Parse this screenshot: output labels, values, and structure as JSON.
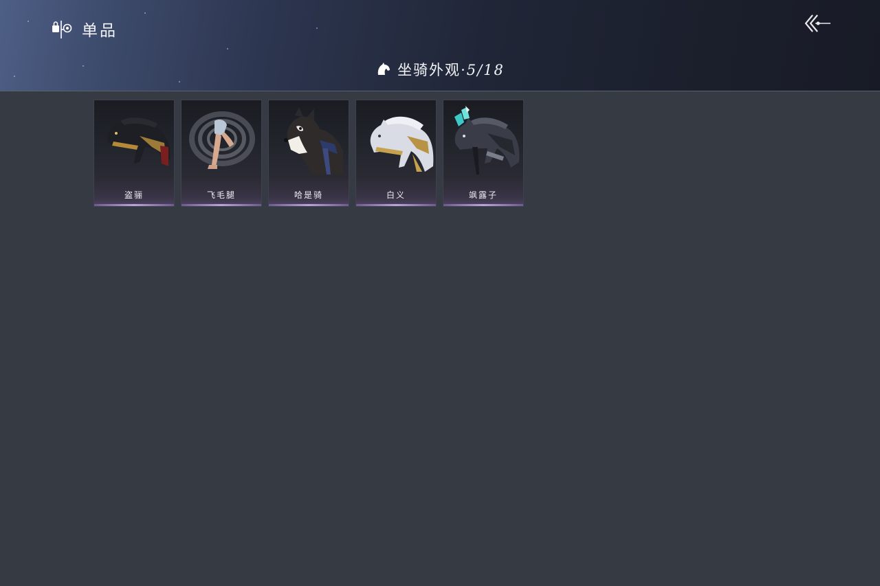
{
  "header": {
    "title": "单品",
    "brand_icon": "bag-eye-icon",
    "back_icon": "double-chevron-back-icon"
  },
  "section": {
    "icon": "horse-head-icon",
    "title": "坐骑外观",
    "separator": "·",
    "count": "5/18"
  },
  "items": [
    {
      "name": "盗骊",
      "art": "black-gold-armored-horse"
    },
    {
      "name": "飞毛腿",
      "art": "spinning-legs"
    },
    {
      "name": "哈是骑",
      "art": "husky-dog"
    },
    {
      "name": "白义",
      "art": "white-gold-horse"
    },
    {
      "name": "飒露子",
      "art": "dark-armored-horse-with-cyan-plume"
    }
  ],
  "colors": {
    "background": "#363a43",
    "header_dark": "#1b1f2c",
    "header_light": "#4e5f86",
    "card_accent": "#b9a6d8"
  }
}
